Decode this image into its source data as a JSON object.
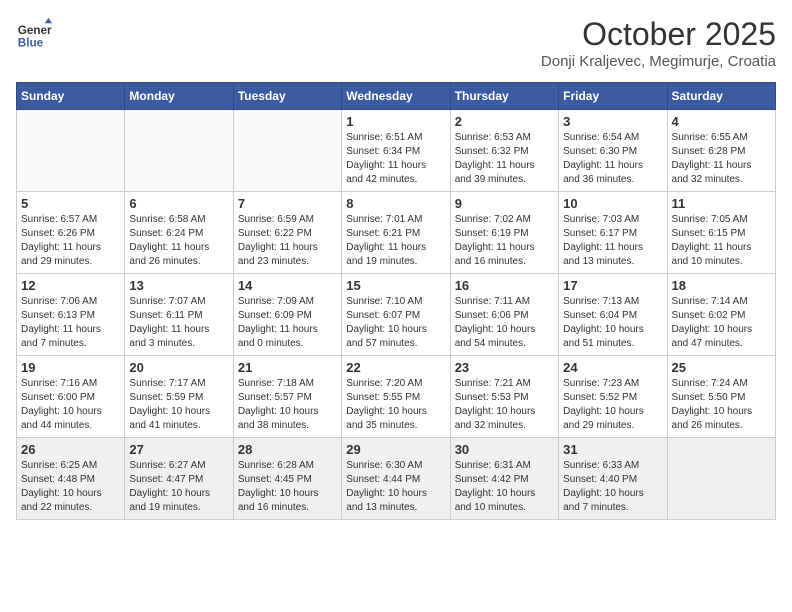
{
  "header": {
    "logo_line1": "General",
    "logo_line2": "Blue",
    "title": "October 2025",
    "subtitle": "Donji Kraljevec, Megimurje, Croatia"
  },
  "weekdays": [
    "Sunday",
    "Monday",
    "Tuesday",
    "Wednesday",
    "Thursday",
    "Friday",
    "Saturday"
  ],
  "weeks": [
    [
      {
        "day": "",
        "info": ""
      },
      {
        "day": "",
        "info": ""
      },
      {
        "day": "",
        "info": ""
      },
      {
        "day": "1",
        "info": "Sunrise: 6:51 AM\nSunset: 6:34 PM\nDaylight: 11 hours\nand 42 minutes."
      },
      {
        "day": "2",
        "info": "Sunrise: 6:53 AM\nSunset: 6:32 PM\nDaylight: 11 hours\nand 39 minutes."
      },
      {
        "day": "3",
        "info": "Sunrise: 6:54 AM\nSunset: 6:30 PM\nDaylight: 11 hours\nand 36 minutes."
      },
      {
        "day": "4",
        "info": "Sunrise: 6:55 AM\nSunset: 6:28 PM\nDaylight: 11 hours\nand 32 minutes."
      }
    ],
    [
      {
        "day": "5",
        "info": "Sunrise: 6:57 AM\nSunset: 6:26 PM\nDaylight: 11 hours\nand 29 minutes."
      },
      {
        "day": "6",
        "info": "Sunrise: 6:58 AM\nSunset: 6:24 PM\nDaylight: 11 hours\nand 26 minutes."
      },
      {
        "day": "7",
        "info": "Sunrise: 6:59 AM\nSunset: 6:22 PM\nDaylight: 11 hours\nand 23 minutes."
      },
      {
        "day": "8",
        "info": "Sunrise: 7:01 AM\nSunset: 6:21 PM\nDaylight: 11 hours\nand 19 minutes."
      },
      {
        "day": "9",
        "info": "Sunrise: 7:02 AM\nSunset: 6:19 PM\nDaylight: 11 hours\nand 16 minutes."
      },
      {
        "day": "10",
        "info": "Sunrise: 7:03 AM\nSunset: 6:17 PM\nDaylight: 11 hours\nand 13 minutes."
      },
      {
        "day": "11",
        "info": "Sunrise: 7:05 AM\nSunset: 6:15 PM\nDaylight: 11 hours\nand 10 minutes."
      }
    ],
    [
      {
        "day": "12",
        "info": "Sunrise: 7:06 AM\nSunset: 6:13 PM\nDaylight: 11 hours\nand 7 minutes."
      },
      {
        "day": "13",
        "info": "Sunrise: 7:07 AM\nSunset: 6:11 PM\nDaylight: 11 hours\nand 3 minutes."
      },
      {
        "day": "14",
        "info": "Sunrise: 7:09 AM\nSunset: 6:09 PM\nDaylight: 11 hours\nand 0 minutes."
      },
      {
        "day": "15",
        "info": "Sunrise: 7:10 AM\nSunset: 6:07 PM\nDaylight: 10 hours\nand 57 minutes."
      },
      {
        "day": "16",
        "info": "Sunrise: 7:11 AM\nSunset: 6:06 PM\nDaylight: 10 hours\nand 54 minutes."
      },
      {
        "day": "17",
        "info": "Sunrise: 7:13 AM\nSunset: 6:04 PM\nDaylight: 10 hours\nand 51 minutes."
      },
      {
        "day": "18",
        "info": "Sunrise: 7:14 AM\nSunset: 6:02 PM\nDaylight: 10 hours\nand 47 minutes."
      }
    ],
    [
      {
        "day": "19",
        "info": "Sunrise: 7:16 AM\nSunset: 6:00 PM\nDaylight: 10 hours\nand 44 minutes."
      },
      {
        "day": "20",
        "info": "Sunrise: 7:17 AM\nSunset: 5:59 PM\nDaylight: 10 hours\nand 41 minutes."
      },
      {
        "day": "21",
        "info": "Sunrise: 7:18 AM\nSunset: 5:57 PM\nDaylight: 10 hours\nand 38 minutes."
      },
      {
        "day": "22",
        "info": "Sunrise: 7:20 AM\nSunset: 5:55 PM\nDaylight: 10 hours\nand 35 minutes."
      },
      {
        "day": "23",
        "info": "Sunrise: 7:21 AM\nSunset: 5:53 PM\nDaylight: 10 hours\nand 32 minutes."
      },
      {
        "day": "24",
        "info": "Sunrise: 7:23 AM\nSunset: 5:52 PM\nDaylight: 10 hours\nand 29 minutes."
      },
      {
        "day": "25",
        "info": "Sunrise: 7:24 AM\nSunset: 5:50 PM\nDaylight: 10 hours\nand 26 minutes."
      }
    ],
    [
      {
        "day": "26",
        "info": "Sunrise: 6:25 AM\nSunset: 4:48 PM\nDaylight: 10 hours\nand 22 minutes."
      },
      {
        "day": "27",
        "info": "Sunrise: 6:27 AM\nSunset: 4:47 PM\nDaylight: 10 hours\nand 19 minutes."
      },
      {
        "day": "28",
        "info": "Sunrise: 6:28 AM\nSunset: 4:45 PM\nDaylight: 10 hours\nand 16 minutes."
      },
      {
        "day": "29",
        "info": "Sunrise: 6:30 AM\nSunset: 4:44 PM\nDaylight: 10 hours\nand 13 minutes."
      },
      {
        "day": "30",
        "info": "Sunrise: 6:31 AM\nSunset: 4:42 PM\nDaylight: 10 hours\nand 10 minutes."
      },
      {
        "day": "31",
        "info": "Sunrise: 6:33 AM\nSunset: 4:40 PM\nDaylight: 10 hours\nand 7 minutes."
      },
      {
        "day": "",
        "info": ""
      }
    ]
  ]
}
